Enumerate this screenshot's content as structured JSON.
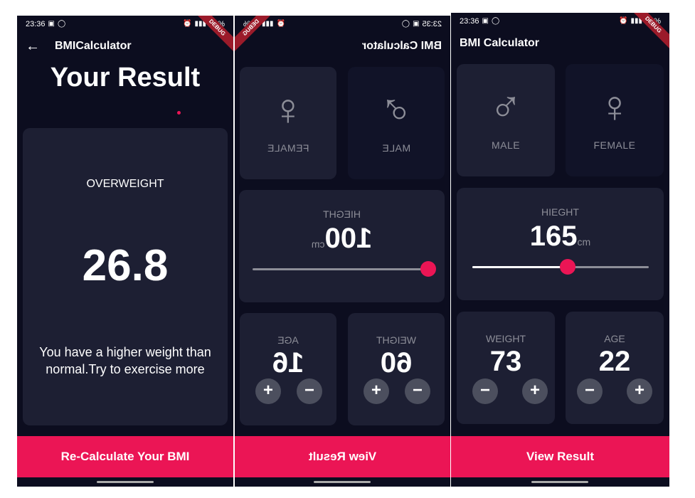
{
  "colors": {
    "background": "#0c0d1f",
    "card": "#1d1f33",
    "card_selected": "#111328",
    "accent": "#eb1555",
    "muted": "#8d8e98",
    "button_round": "#4c4f5e"
  },
  "icons": {
    "female": "♀",
    "male": "♂",
    "back": "←",
    "minus": "−",
    "plus": "+"
  },
  "screen1": {
    "status": {
      "time": "23:36",
      "battery": "80%"
    },
    "debug_label": "DEBUG",
    "app_title": "BMICalculator",
    "heading": "Your Result",
    "result_status": "OVERWEIGHT",
    "bmi_value": "26.8",
    "advice": "You have a higher weight than normal.Try to exercise more",
    "button_label": "Re-Calculate Your BMI"
  },
  "screen2": {
    "status": {
      "time": "23:35",
      "battery": "80%"
    },
    "debug_label": "DEBUG",
    "app_title": "BMI Calculator",
    "female_label": "FEMALE",
    "male_label": "MALE",
    "height_label": "HIEGHT",
    "height_value": "100",
    "height_unit": "cm",
    "height_level": 0.0,
    "weight_label": "WEIGHT",
    "weight_value": "60",
    "age_label": "AGE",
    "age_value": "16",
    "button_label": "View Result"
  },
  "screen3": {
    "status": {
      "time": "23:36",
      "battery": "80%"
    },
    "debug_label": "DEBUG",
    "app_title": "BMI Calculator",
    "male_label": "MALE",
    "female_label": "FEMALE",
    "height_label": "HIEGHT",
    "height_value": "165",
    "height_unit": "cm",
    "height_level": 0.54,
    "weight_label": "WEIGHT",
    "weight_value": "73",
    "age_label": "AGE",
    "age_value": "22",
    "button_label": "View Result"
  }
}
